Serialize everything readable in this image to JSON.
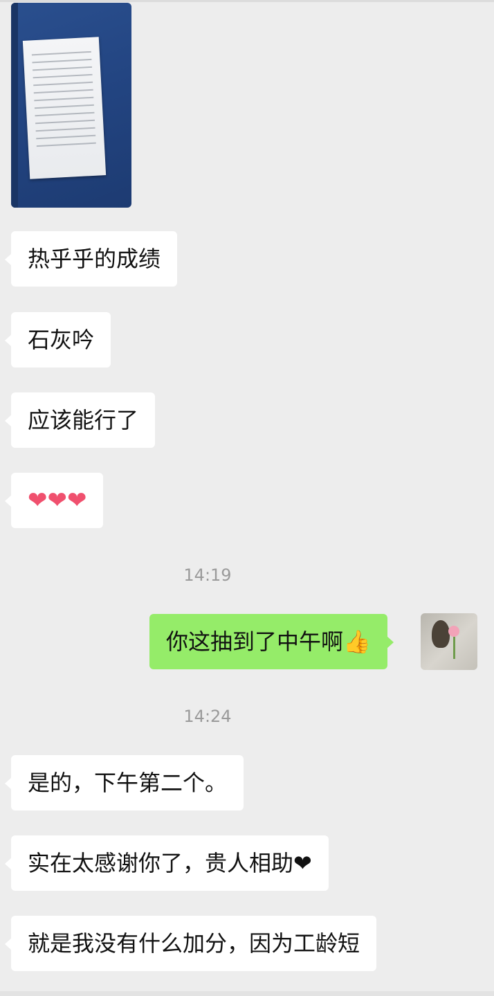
{
  "messages": [
    {
      "text": "热乎乎的成绩"
    },
    {
      "text": "石灰吟"
    },
    {
      "text": "应该能行了"
    },
    {
      "text": "❤❤❤"
    },
    {
      "text": "你这抽到了中午啊👍"
    },
    {
      "text": "是的，下午第二个。"
    },
    {
      "text": "实在太感谢你了，贵人相助❤"
    },
    {
      "text": "就是我没有什么加分，因为工龄短"
    }
  ],
  "timestamps": [
    "14:19",
    "14:24"
  ],
  "colors": {
    "background": "#ededed",
    "incoming_bubble": "#ffffff",
    "outgoing_bubble": "#95ec69",
    "timestamp": "#9a9a9a"
  }
}
